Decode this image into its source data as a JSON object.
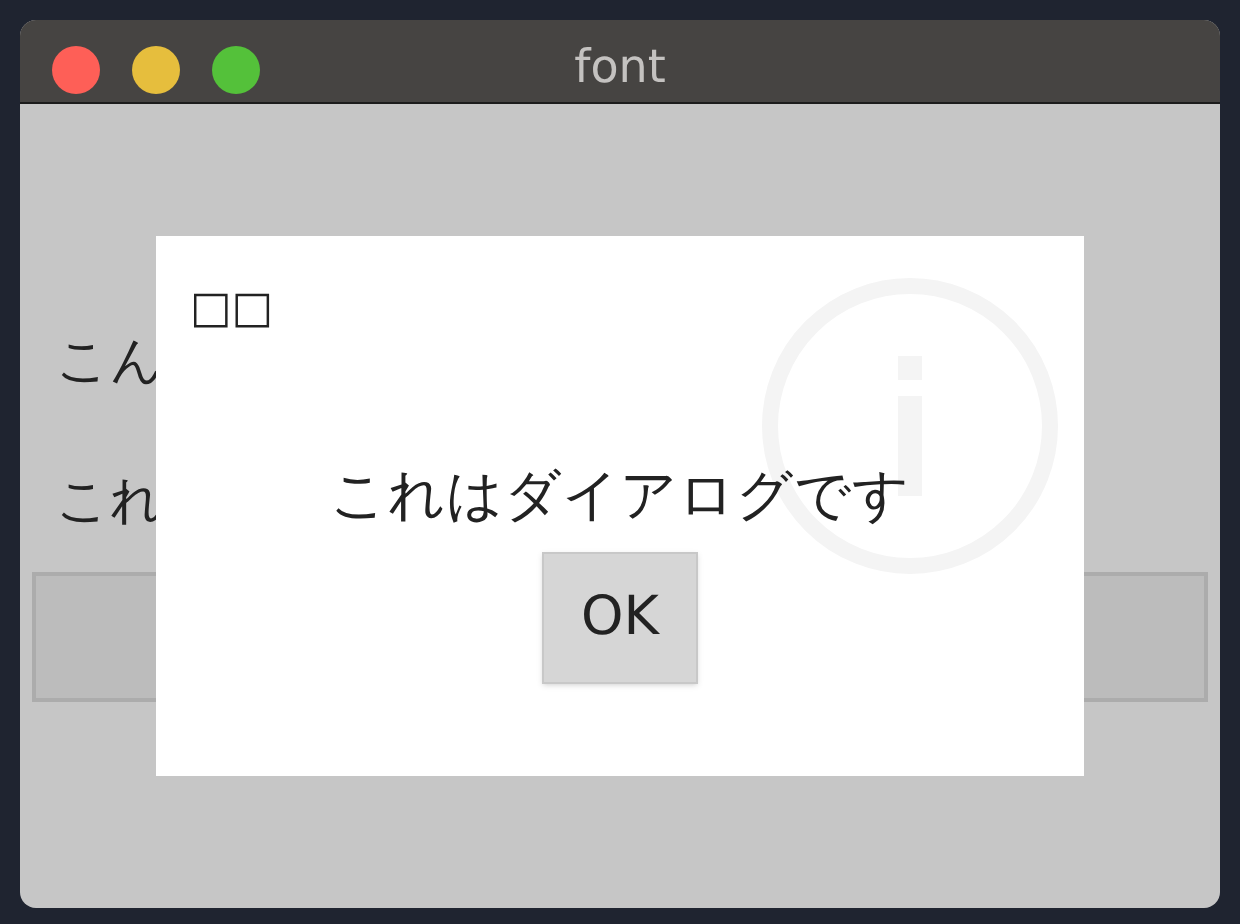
{
  "window": {
    "title": "font"
  },
  "content": {
    "labels": [
      "こん",
      "これ"
    ]
  },
  "dialog": {
    "title": "□□",
    "message": "これはダイアログです",
    "buttons": [
      "OK"
    ]
  }
}
